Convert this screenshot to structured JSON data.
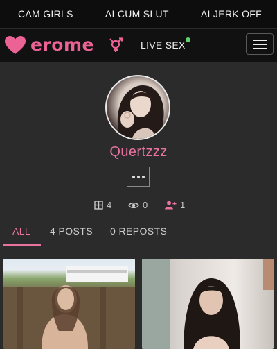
{
  "promo": {
    "items": [
      "CAM GIRLS",
      "AI CUM SLUT",
      "AI JERK OFF"
    ]
  },
  "nav": {
    "logo_text": "erome",
    "live_label": "LIVE SEX"
  },
  "profile": {
    "username": "Quertzzz"
  },
  "stats": {
    "albums": "4",
    "views": "0",
    "followers": "1"
  },
  "tabs": [
    "ALL",
    "4 POSTS",
    "0 REPOSTS"
  ],
  "colors": {
    "brand_pink": "#eb6395",
    "accent_pink": "#e8739f",
    "live_green": "#5fd26e",
    "page_bg": "#2b2b2b"
  }
}
